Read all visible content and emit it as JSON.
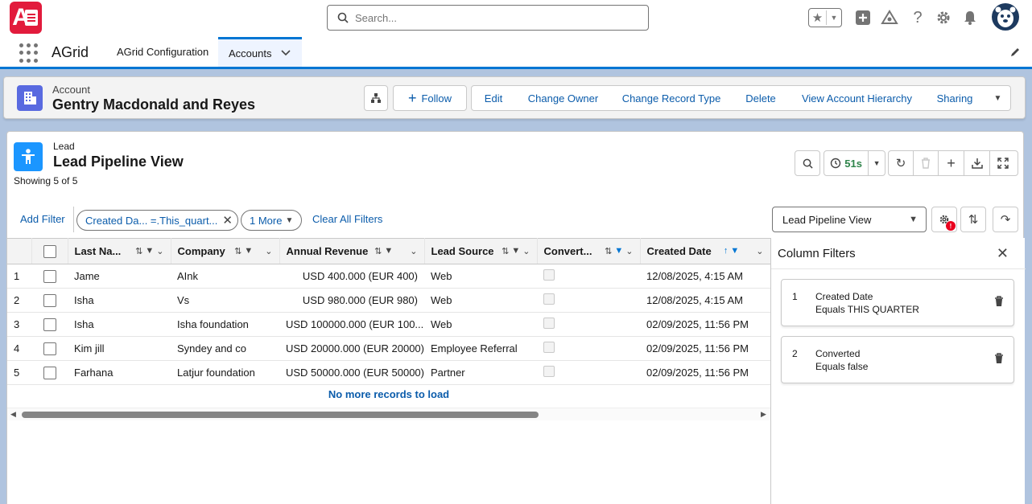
{
  "header": {
    "app_logo": "A",
    "search_placeholder": "Search..."
  },
  "nav": {
    "app_name": "AGrid",
    "tabs": [
      {
        "label": "AGrid Configuration"
      },
      {
        "label": "Accounts"
      }
    ]
  },
  "record": {
    "type": "Account",
    "name": "Gentry Macdonald and Reyes",
    "actions": {
      "follow": "Follow",
      "edit": "Edit",
      "change_owner": "Change Owner",
      "change_record_type": "Change Record Type",
      "delete": "Delete",
      "view_hierarchy": "View Account Hierarchy",
      "sharing": "Sharing"
    }
  },
  "grid": {
    "object": "Lead",
    "title": "Lead Pipeline View",
    "showing": "Showing 5 of 5",
    "refresh_timer": "51s",
    "add_filter": "Add Filter",
    "filter_pill": "Created Da... =.This_quart...",
    "more_pill": "1 More",
    "clear_filters": "Clear All Filters",
    "view_select": "Lead Pipeline View",
    "settings_badge": "!",
    "columns": [
      "Last Na...",
      "Company",
      "Annual Revenue",
      "Lead Source",
      "Convert...",
      "Created Date"
    ],
    "rows": [
      {
        "n": "1",
        "last_name": "Jame",
        "company": "AInk",
        "revenue": "USD 400.000 (EUR 400)",
        "source": "Web",
        "created": "12/08/2025, 4:15 AM"
      },
      {
        "n": "2",
        "last_name": "Isha",
        "company": "Vs",
        "revenue": "USD 980.000 (EUR 980)",
        "source": "Web",
        "created": "12/08/2025, 4:15 AM"
      },
      {
        "n": "3",
        "last_name": "Isha",
        "company": "Isha foundation",
        "revenue": "USD 100000.000 (EUR 100...",
        "source": "Web",
        "created": "02/09/2025, 11:56 PM"
      },
      {
        "n": "4",
        "last_name": "Kim jill",
        "company": "Syndey and co",
        "revenue": "USD 20000.000 (EUR 20000)",
        "source": "Employee Referral",
        "created": "02/09/2025, 11:56 PM"
      },
      {
        "n": "5",
        "last_name": "Farhana",
        "company": "Latjur foundation",
        "revenue": "USD 50000.000 (EUR 50000)",
        "source": "Partner",
        "created": "02/09/2025, 11:56 PM"
      }
    ],
    "no_more": "No more records to load"
  },
  "column_filters": {
    "title": "Column Filters",
    "items": [
      {
        "index": "1",
        "field": "Created Date",
        "condition": "Equals THIS QUARTER"
      },
      {
        "index": "2",
        "field": "Converted",
        "condition": "Equals false"
      }
    ]
  },
  "colors": {
    "brand_blue": "#0176d3",
    "link": "#0b5cab",
    "timer_green": "#2e844a",
    "badge_red": "#ea001e"
  }
}
